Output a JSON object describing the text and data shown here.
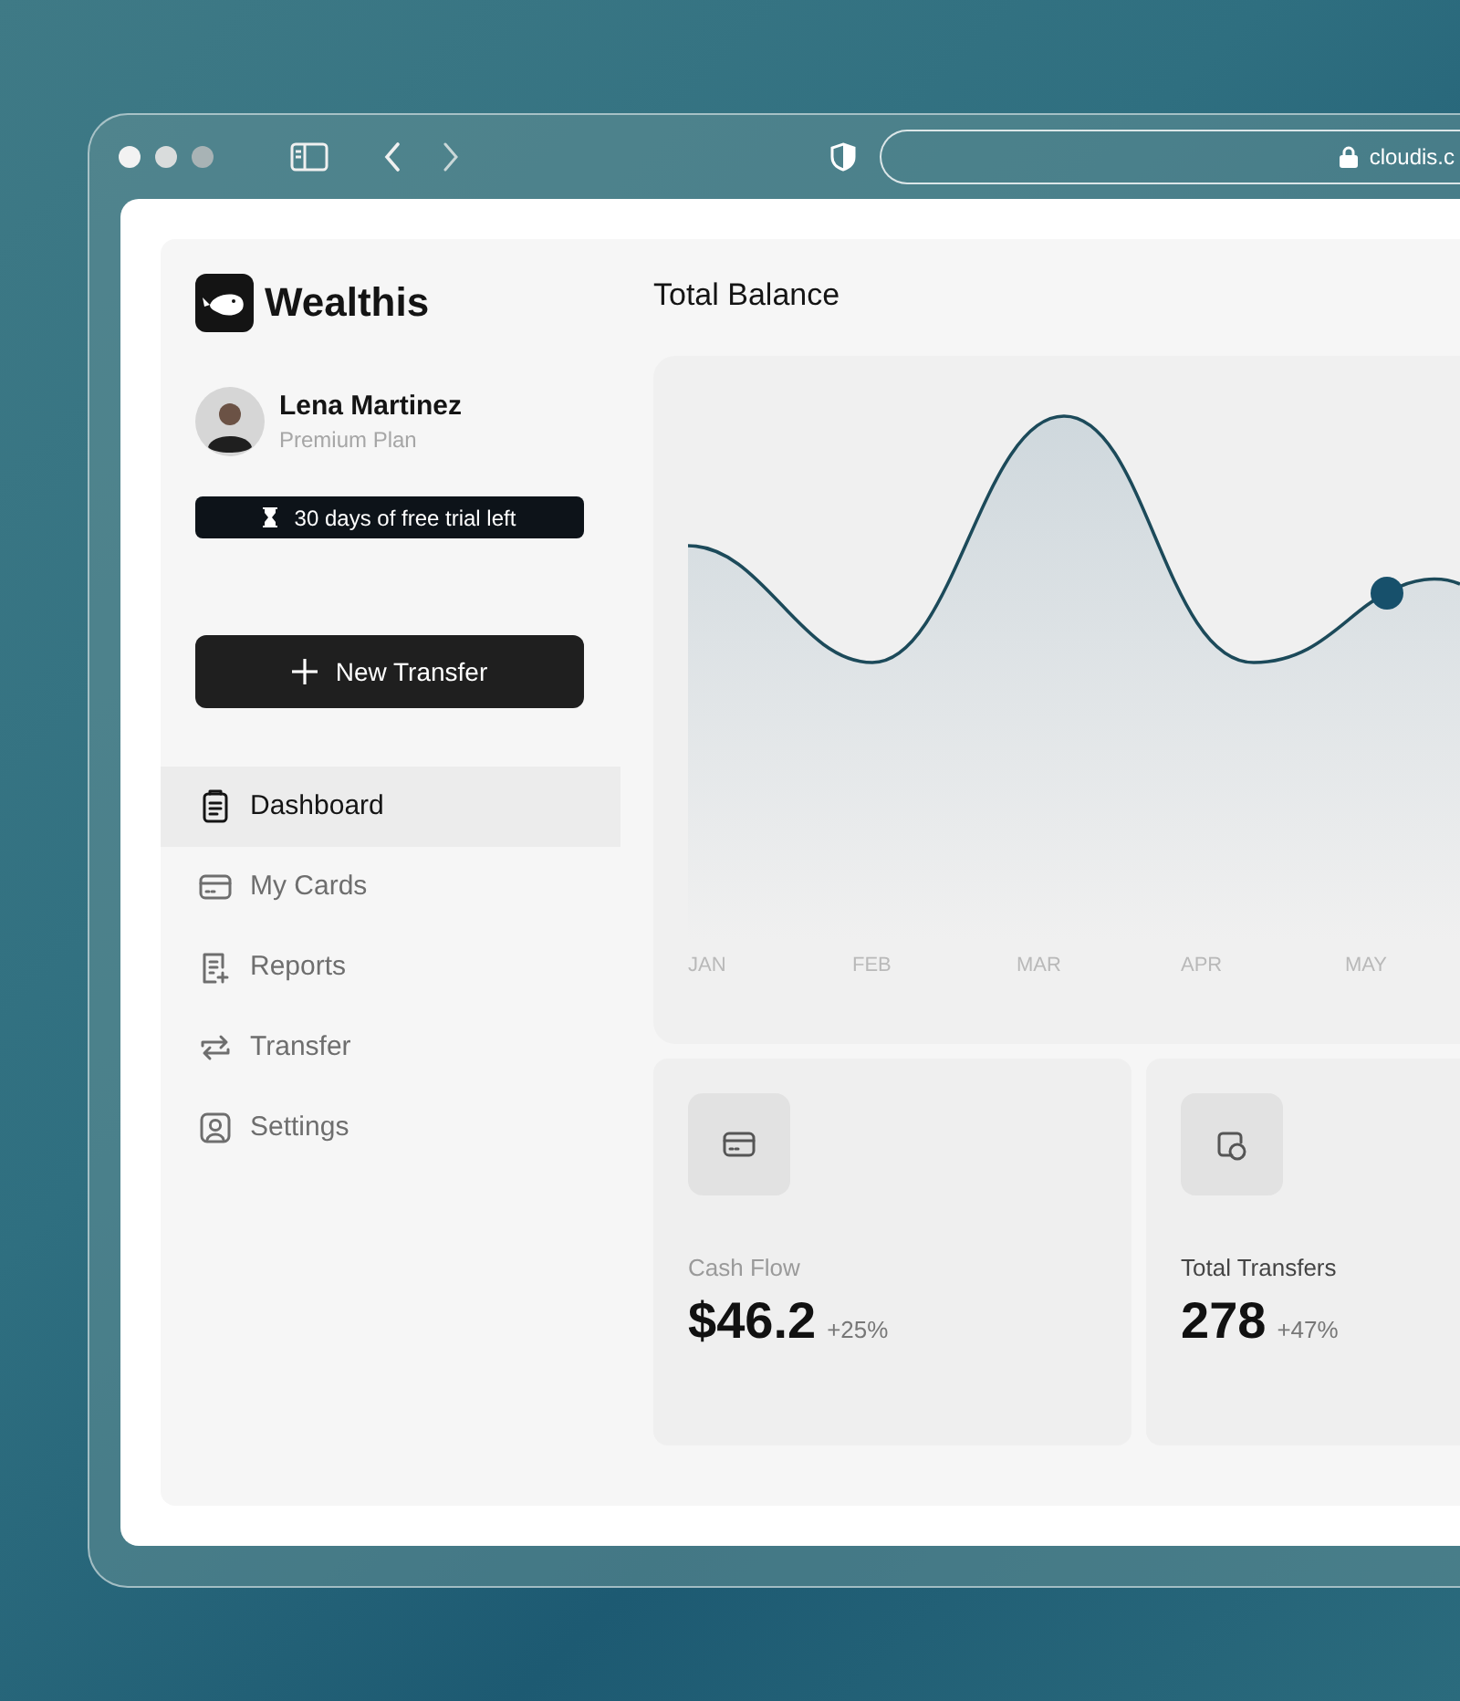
{
  "browser": {
    "url": "cloudis.c"
  },
  "app": {
    "name": "Wealthis"
  },
  "user": {
    "name": "Lena Martinez",
    "plan": "Premium Plan"
  },
  "trial_badge": "30 days of free trial left",
  "new_transfer_button": "New Transfer",
  "nav": [
    {
      "kind": "dashboard",
      "label": "Dashboard",
      "selected": true
    },
    {
      "kind": "cards",
      "label": "My Cards",
      "selected": false
    },
    {
      "kind": "reports",
      "label": "Reports",
      "selected": false
    },
    {
      "kind": "transfer",
      "label": "Transfer",
      "selected": false
    },
    {
      "kind": "settings",
      "label": "Settings",
      "selected": false
    }
  ],
  "balance": {
    "title": "Total Balance",
    "months": [
      "JAN",
      "FEB",
      "MAR",
      "APR",
      "MAY"
    ]
  },
  "stats": [
    {
      "kind": "card",
      "label": "Cash Flow",
      "value": "$46.2",
      "change": "+25%",
      "dimmed": true
    },
    {
      "kind": "transfers",
      "label": "Total Transfers",
      "value": "278",
      "change": "+47%",
      "dimmed": false
    }
  ]
}
